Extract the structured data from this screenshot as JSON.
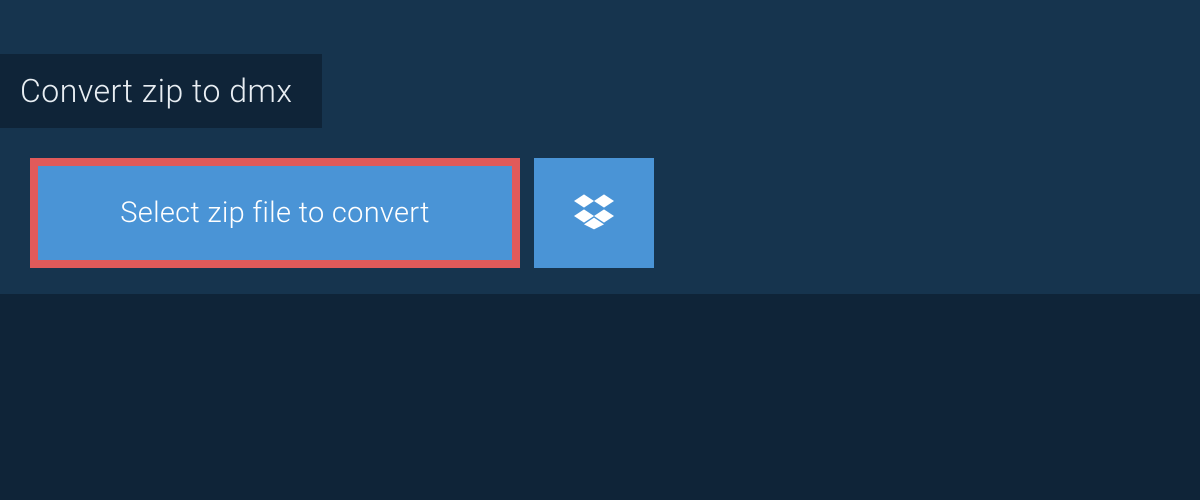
{
  "title": "Convert zip to dmx",
  "select_button_label": "Select zip file to convert",
  "colors": {
    "page_bg": "#0f2438",
    "section_bg": "#16344e",
    "button_bg": "#4a94d6",
    "highlight_border": "#e05a5a",
    "text_light": "#ffffff",
    "title_text": "#e8eef3"
  }
}
